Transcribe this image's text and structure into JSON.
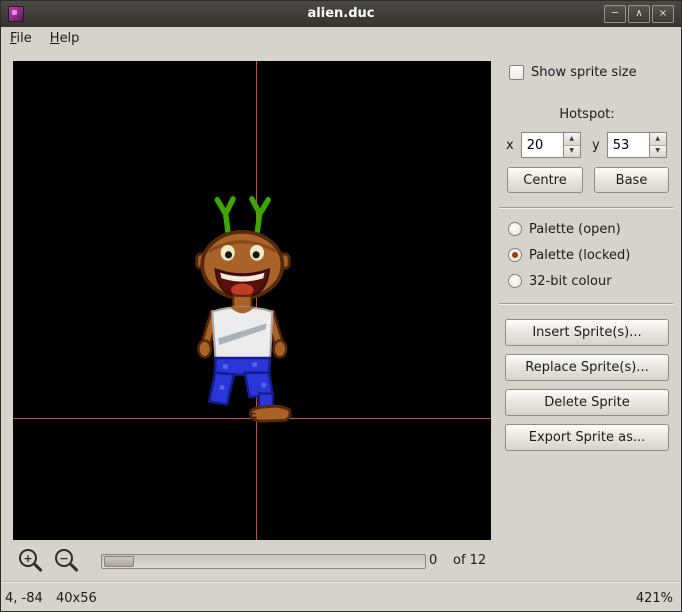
{
  "window": {
    "title": "alien.duc"
  },
  "titlebar_icons": {
    "minimize": "─",
    "maximize": "∧",
    "close": "×"
  },
  "menubar": {
    "file": {
      "accel": "F",
      "rest": "ile"
    },
    "help": {
      "accel": "H",
      "rest": "elp"
    }
  },
  "panel": {
    "show_sprite_size_label": "Show sprite size",
    "show_sprite_size_checked": false,
    "hotspot_label": "Hotspot:",
    "x_label": "x",
    "x_value": "20",
    "y_label": "y",
    "y_value": "53",
    "centre_button": "Centre",
    "base_button": "Base",
    "palette_options": [
      {
        "label": "Palette (open)",
        "selected": false
      },
      {
        "label": "Palette (locked)",
        "selected": true
      },
      {
        "label": "32-bit colour",
        "selected": false
      }
    ],
    "insert_button": "Insert Sprite(s)...",
    "replace_button": "Replace Sprite(s)...",
    "delete_button": "Delete Sprite",
    "export_button": "Export Sprite as..."
  },
  "icons": {
    "spin_up": "▲",
    "spin_down": "▼",
    "zoom_in_sign": "+",
    "zoom_out_sign": "−"
  },
  "framebar": {
    "current": "0",
    "of_total": "of 12"
  },
  "statusbar": {
    "coords": "4, -84",
    "size": "40x56",
    "zoom": "421%"
  },
  "colors": {
    "crosshair": "#cf4a3e",
    "canvas_bg": "#000000",
    "radio_dot": "#a33a00"
  }
}
